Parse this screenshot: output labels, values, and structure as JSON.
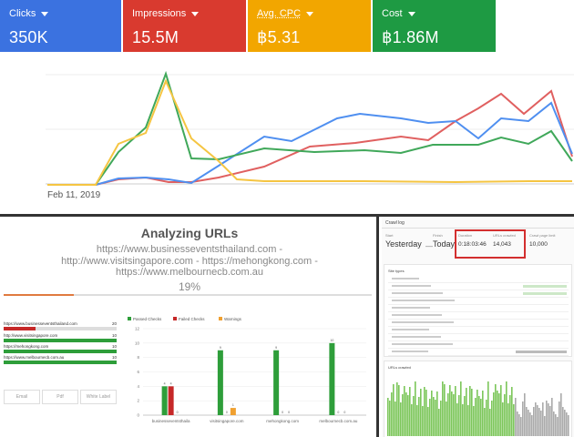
{
  "tiles": [
    {
      "label": "Clicks",
      "value": "350K",
      "color": "#3b72e0"
    },
    {
      "label": "Impressions",
      "value": "15.5M",
      "color": "#d93a2f"
    },
    {
      "label": "Avg. CPC",
      "value": "฿5.31",
      "color": "#f2a600"
    },
    {
      "label": "Cost",
      "value": "฿1.86M",
      "color": "#1e9a43"
    }
  ],
  "top_chart": {
    "date_label": "Feb 11, 2019"
  },
  "analyzing": {
    "title": "Analyzing URLs",
    "urls_line1": "https://www.businesseventsthailand.com -",
    "urls_line2": "http://www.visitsingapore.com - https://mehongkong.com -",
    "urls_line3": "https://www.melbournecb.com.au",
    "percent": "19%",
    "progress": 0.19
  },
  "url_list": [
    {
      "url": "https://www.businesseventsthailand.com",
      "count": "20",
      "color": "#c62828"
    },
    {
      "url": "http://www.visitsingapore.com",
      "count": "10",
      "color": "#2e9e3a"
    },
    {
      "url": "https://mehongkong.com",
      "count": "10",
      "color": "#2e9e3a"
    },
    {
      "url": "https://www.melbournecb.com.au",
      "count": "10",
      "color": "#2e9e3a"
    }
  ],
  "buttons": {
    "email": "Email",
    "pdf": "Pdf",
    "white_label": "White Label"
  },
  "bar_chart": {
    "legend": [
      "Passed Checks",
      "Failed Checks",
      "Warnings"
    ],
    "colors": [
      "#2e9e3a",
      "#c62828",
      "#f0a030"
    ],
    "categories": [
      "businesseventsthaila",
      "visitsingapore.com",
      "mehongkong.com",
      "melbournecb.com.au"
    ],
    "passed": [
      4,
      9,
      9,
      10
    ],
    "failed": [
      4,
      0,
      0,
      0
    ],
    "warnings": [
      0,
      1,
      0,
      0
    ],
    "ticks": [
      "0",
      "2",
      "4",
      "6",
      "8",
      "10",
      "12"
    ]
  },
  "crawl_panel": {
    "header": "Crawl log",
    "start_label": "Start",
    "start_value": "Yesterday",
    "finish_label": "Finish",
    "finish_value": "Today",
    "duration_label": "Duration",
    "duration_value": "0:18:03:46",
    "urls_label": "URLs crawled",
    "urls_value": "14,043",
    "limit_label": "Crawl page limit",
    "limit_value": "10,000",
    "section1": "Site types",
    "section2": "URLs crawled"
  }
}
